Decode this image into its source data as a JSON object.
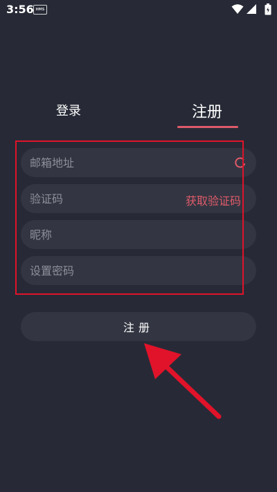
{
  "status_bar": {
    "time": "3:56",
    "badge": "HMS",
    "icons": [
      "wifi-icon",
      "signal-icon",
      "battery-icon"
    ]
  },
  "tabs": [
    {
      "label": "登录",
      "active": false
    },
    {
      "label": "注册",
      "active": true
    }
  ],
  "form": {
    "email_placeholder": "邮箱地址",
    "code_placeholder": "验证码",
    "get_code_label": "获取验证码",
    "nickname_placeholder": "昵称",
    "password_placeholder": "设置密码",
    "submit_label": "注册"
  },
  "colors": {
    "background": "#272a36",
    "field_bg": "#333642",
    "accent": "#e05a6a",
    "annotation_red": "#e0132a"
  }
}
